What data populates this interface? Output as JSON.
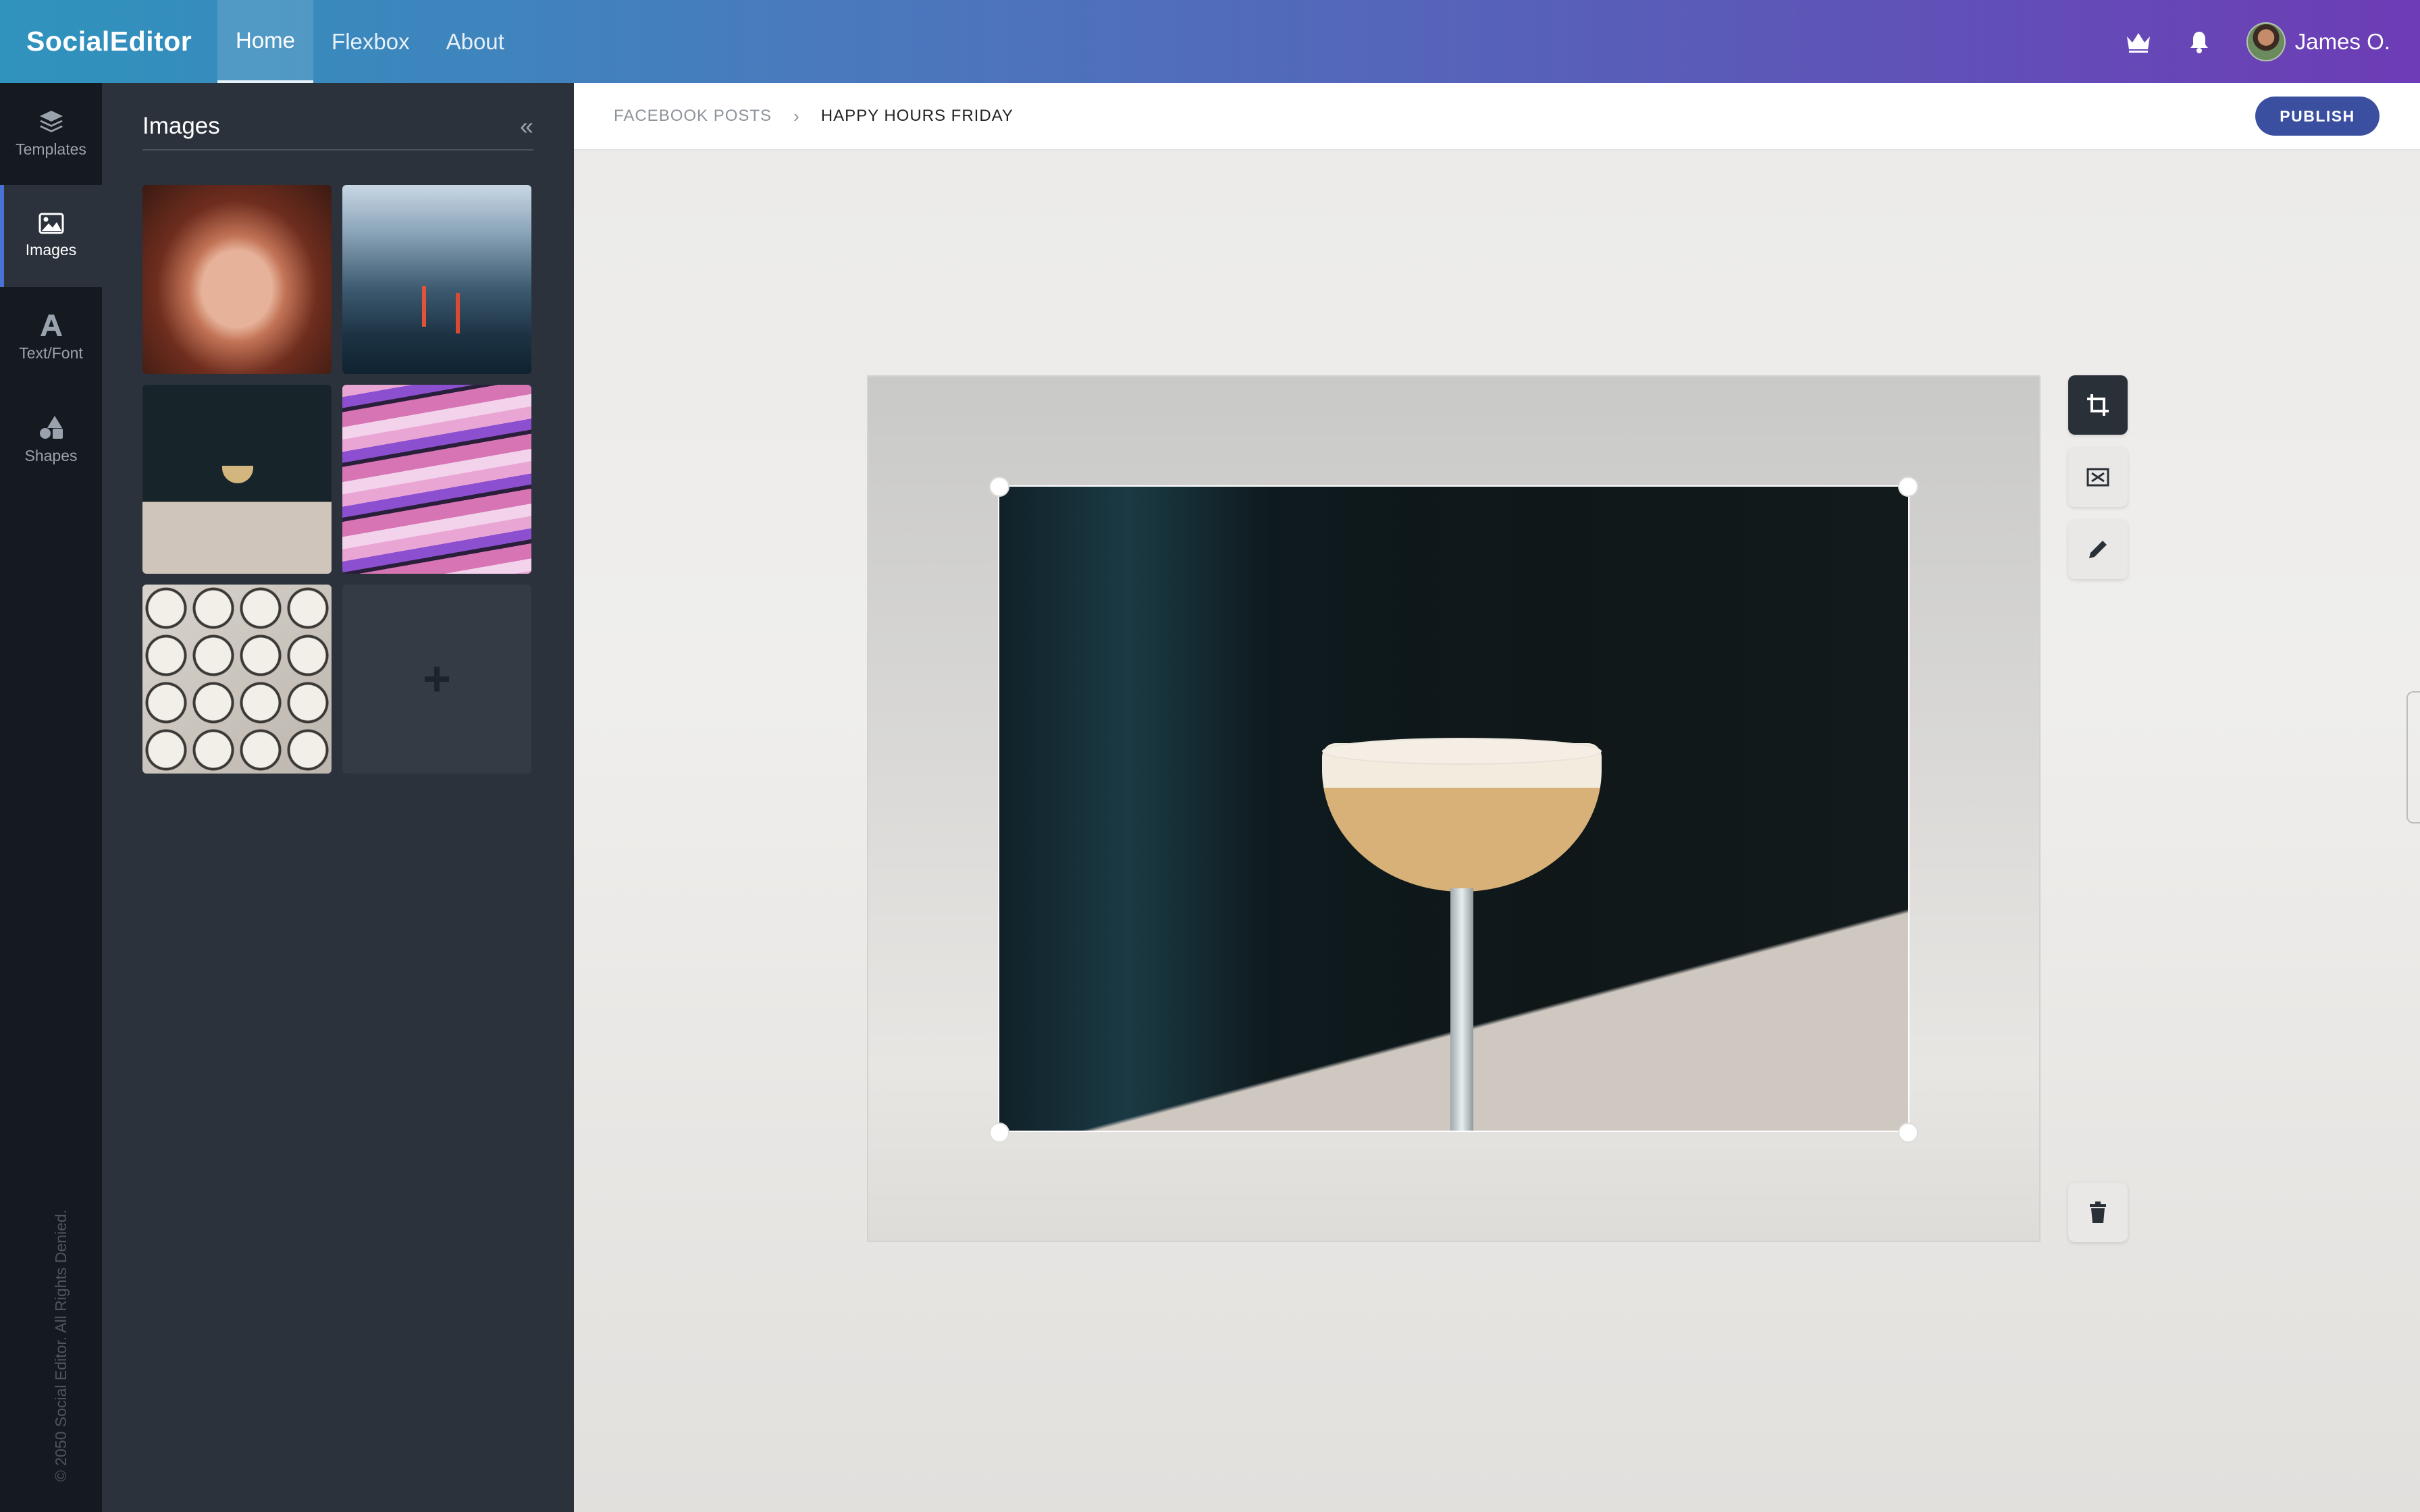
{
  "app": {
    "brand": "SocialEditor"
  },
  "nav": {
    "items": [
      {
        "label": "Home",
        "active": true
      },
      {
        "label": "Flexbox"
      },
      {
        "label": "About"
      }
    ]
  },
  "user": {
    "name": "James O."
  },
  "rail": {
    "items": [
      {
        "label": "Templates",
        "icon": "layers-icon"
      },
      {
        "label": "Images",
        "icon": "image-icon",
        "active": true
      },
      {
        "label": "Text/Font",
        "icon": "text-icon"
      },
      {
        "label": "Shapes",
        "icon": "shapes-icon"
      }
    ],
    "copyright": "© 2050 Social Editor. All Rights Denied."
  },
  "panel": {
    "title": "Images",
    "collapse": "«",
    "add_label": "+"
  },
  "breadcrumb": {
    "parent": "FACEBOOK POSTS",
    "separator": "›",
    "current": "HAPPY HOURS FRIDAY"
  },
  "actions": {
    "publish": "PUBLISH"
  },
  "colors": {
    "accent": "#3b4fa0",
    "rail_active": "#4a72d3"
  }
}
